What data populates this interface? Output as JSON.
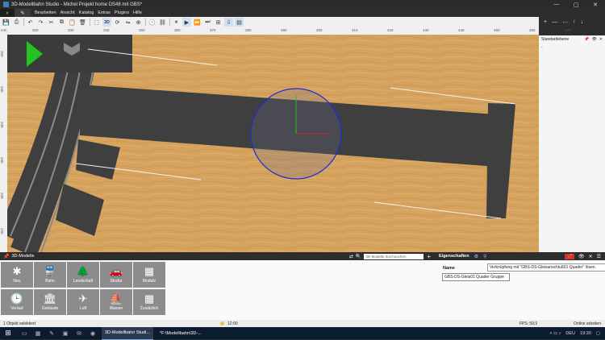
{
  "window": {
    "title": "3D-Modellbahn Studio - Michel Projekt home DS48 mit GBS*",
    "min": "—",
    "max": "▢",
    "close": "✕"
  },
  "menu": {
    "back": "‹",
    "pen": "✎",
    "items": [
      "Bearbeiten",
      "Ansicht",
      "Katalog",
      "Extras",
      "Plugins",
      "Hilfe"
    ]
  },
  "toolbar": {
    "mode2d": "2D",
    "mode3d": "3D"
  },
  "ruler": {
    "unit": "mm",
    "ticks": [
      "320",
      "330",
      "340",
      "350",
      "360",
      "370",
      "380",
      "390",
      "400",
      "410",
      "420",
      "430",
      "440",
      "450",
      "460",
      "470"
    ],
    "vticks": [
      "250",
      "245",
      "240",
      "235",
      "230",
      "225"
    ]
  },
  "layers": {
    "item": "Standardebene",
    "sub": "-"
  },
  "models_panel": {
    "title": "3D-Modelle",
    "search_placeholder": "3D-Modelle durchsuchen",
    "categories": [
      {
        "label": "Neu",
        "icon": "✱"
      },
      {
        "label": "Bahn",
        "icon": "🚆"
      },
      {
        "label": "Landschaft",
        "icon": "🌲"
      },
      {
        "label": "Straße",
        "icon": "🚗"
      },
      {
        "label": "Module",
        "icon": "▦"
      },
      {
        "label": "Verlauf",
        "icon": "🕒"
      },
      {
        "label": "Gebäude",
        "icon": "🏛"
      },
      {
        "label": "Luft",
        "icon": "✈"
      },
      {
        "label": "Wasser",
        "icon": "⛵"
      },
      {
        "label": "Zusätzlich",
        "icon": "▦"
      }
    ]
  },
  "properties_panel": {
    "title": "Eigenschaften",
    "name_label": "Name",
    "name_value": "GBS-DS-Gleis01 Quader Gruppe",
    "tooltip": "Verknüpfung mit \"GBS-DS-Gleisanschluß01 Quader\" lösen."
  },
  "status": {
    "selection": "1 Objekt selektiert",
    "time": "12:00",
    "fps": "FPS: 59,9",
    "online": "Online arbeiten"
  },
  "taskbar": {
    "apps": [
      "3D-Modellbahn Studi...",
      "*F:\\Modellbahn\\3D-..."
    ],
    "lang": "DEU",
    "clock": "19:30"
  },
  "colors": {
    "track": "#3f3f3f",
    "ground": "#d6a35f",
    "selection_circle": "#1d2bd6",
    "accent_play": "#22c322"
  }
}
